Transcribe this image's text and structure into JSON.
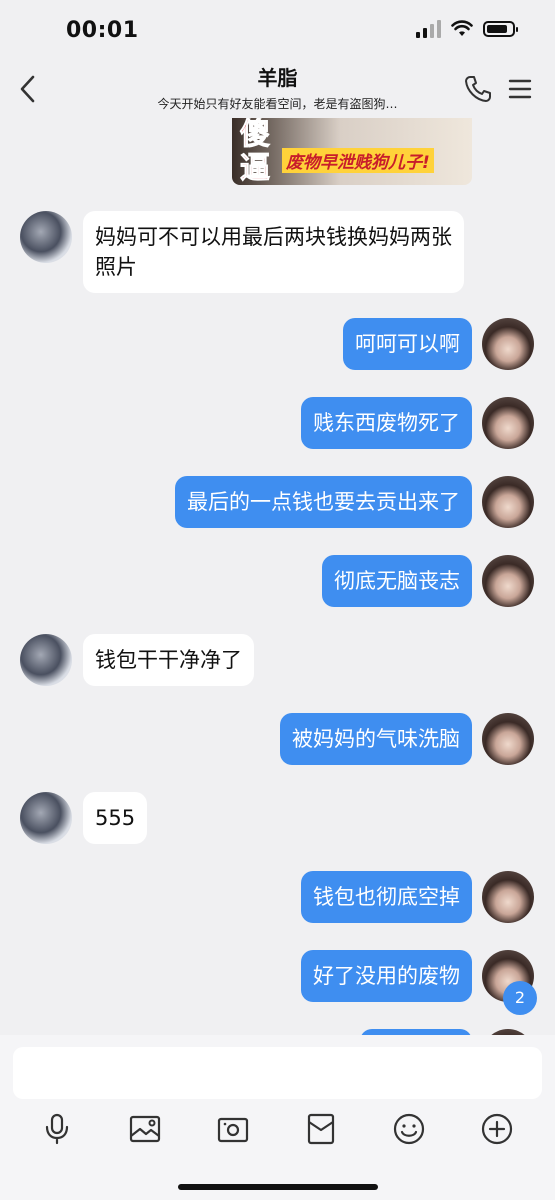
{
  "status": {
    "time": "00:01"
  },
  "header": {
    "title": "羊脂",
    "subtitle": "今天开始只有好友能看空间，老是有盗图狗…"
  },
  "image_message": {
    "line1": "傻",
    "line2": "逼",
    "caption": "废物早泄贱狗儿子!"
  },
  "messages": [
    {
      "side": "left",
      "text": "妈妈可不可以用最后两块钱换妈妈两张照片"
    },
    {
      "side": "right",
      "text": "呵呵可以啊"
    },
    {
      "side": "right",
      "text": "贱东西废物死了"
    },
    {
      "side": "right",
      "text": "最后的一点钱也要去贡出来了"
    },
    {
      "side": "right",
      "text": "彻底无脑丧志"
    },
    {
      "side": "left",
      "text": "钱包干干净净了"
    },
    {
      "side": "right",
      "text": "被妈妈的气味洗脑"
    },
    {
      "side": "left",
      "text": "555"
    },
    {
      "side": "right",
      "text": "钱包也彻底空掉"
    },
    {
      "side": "right",
      "text": "好了没用的废物"
    }
  ],
  "unread_badge": "2",
  "composer": {
    "input_value": ""
  },
  "toolbar": [
    "mic-icon",
    "photo-icon",
    "camera-icon",
    "red-packet-icon",
    "emoji-icon",
    "plus-icon"
  ]
}
